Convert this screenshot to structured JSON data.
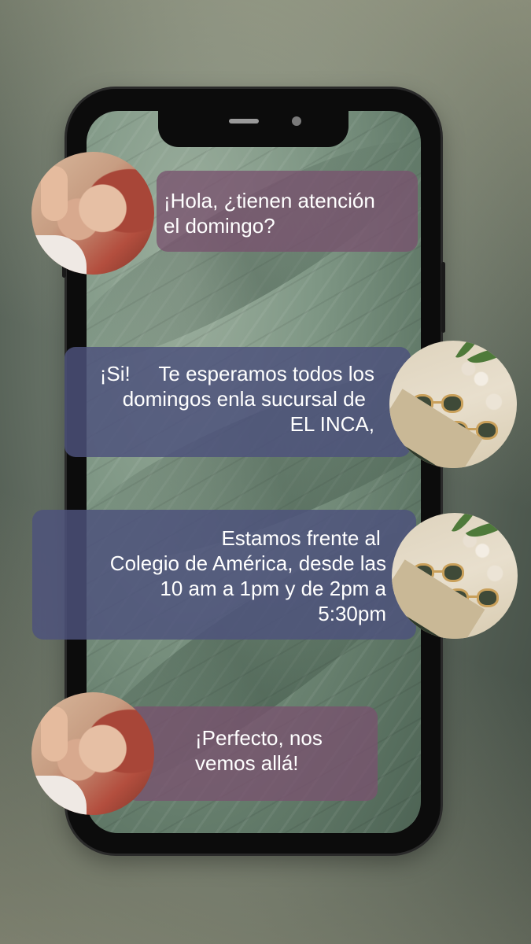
{
  "messages": [
    {
      "lines": [
        "¡Hola, ¿tienen atención",
        "el domingo?"
      ],
      "sender": "customer"
    },
    {
      "lines": [
        "¡Si!     Te esperamos todos los",
        "domingos enla sucursal de",
        "EL INCA,"
      ],
      "sender": "store"
    },
    {
      "lines": [
        "Estamos frente al ",
        "Colegio de América, desde las",
        "10 am a 1pm y de 2pm a",
        "5:30pm"
      ],
      "sender": "store"
    },
    {
      "lines": [
        "¡Perfecto, nos",
        "vemos allá!"
      ],
      "sender": "customer"
    }
  ],
  "colors": {
    "customer_bubble": "#78526E",
    "store_bubble": "#4E527C",
    "phone_frame": "#0c0c0c"
  },
  "icons": {
    "customer_avatar": "woman-portrait-avatar",
    "store_avatar": "sunglasses-product-avatar"
  }
}
